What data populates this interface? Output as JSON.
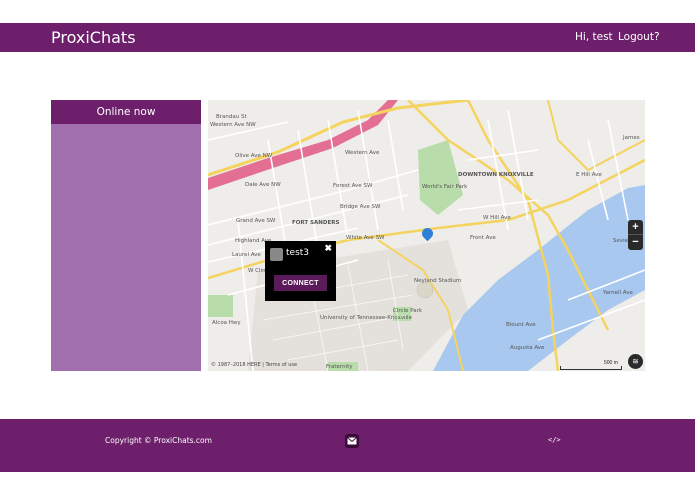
{
  "navbar": {
    "brand": "ProxiChats",
    "greeting": "Hi, test",
    "logout": "Logout?"
  },
  "sidebar": {
    "header": "Online now",
    "users": []
  },
  "map": {
    "popup": {
      "username": "test3",
      "connect_label": "CONNECT",
      "close_label": "✖"
    },
    "zoom_in": "+",
    "zoom_out": "−",
    "attribution": "© 1987–2018 HERE | Terms of use",
    "scale": "500 m",
    "labels": {
      "brandau": "Brandau St",
      "western_top": "Western Ave NW",
      "olive": "Olive Ave NW",
      "dale": "Dale Ave NW",
      "western": "Western Ave",
      "forest": "Forest Ave SW",
      "bridge": "Bridge Ave SW",
      "grand": "Grand Ave SW",
      "highland": "Highland Ave",
      "laurel": "Laurel Ave",
      "clinch": "W Clinch",
      "white": "White Ave SW",
      "fort_sanders": "FORT SANDERS",
      "downtown": "DOWNTOWN KNOXVILLE",
      "hill": "W Hill Ave",
      "front": "Front Ave",
      "hill_e": "E Hill Ave",
      "james": "James",
      "world_fair": "World's Fair Park",
      "neyland": "Neyland Stadium",
      "university": "University of Tennessee-Knoxville",
      "circle_park": "Circle Park",
      "blount": "Blount Ave",
      "augusta": "Augusta Ave",
      "yarnell": "Yarnell Ave",
      "alcoa": "Alcoa Hwy",
      "fraternity": "Fraternity",
      "sevier": "Sevier"
    }
  },
  "footer": {
    "copyright": "Copyright © ProxiChats.com",
    "code_icon": "</>"
  },
  "colors": {
    "brand_purple": "#6e1f6c",
    "sidebar_purple": "#a16eae",
    "river_blue": "#a8c8f0",
    "park_green": "#b8dcaa"
  }
}
